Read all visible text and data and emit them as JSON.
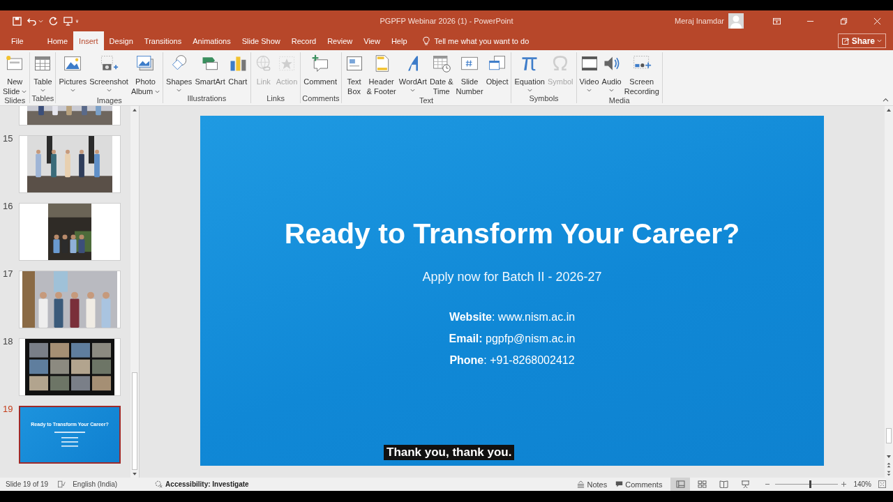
{
  "window": {
    "title": "PGPFP Webinar 2026 (1)  -  PowerPoint",
    "user": "Meraj Inamdar"
  },
  "tabs": [
    {
      "label": "File",
      "selected": false
    },
    {
      "label": "Home",
      "selected": false
    },
    {
      "label": "Insert",
      "selected": true
    },
    {
      "label": "Design",
      "selected": false
    },
    {
      "label": "Transitions",
      "selected": false
    },
    {
      "label": "Animations",
      "selected": false
    },
    {
      "label": "Slide Show",
      "selected": false
    },
    {
      "label": "Record",
      "selected": false
    },
    {
      "label": "Review",
      "selected": false
    },
    {
      "label": "View",
      "selected": false
    },
    {
      "label": "Help",
      "selected": false
    }
  ],
  "tell_me": "Tell me what you want to do",
  "share": "Share",
  "ribbon": [
    {
      "label": "Slides",
      "items": [
        {
          "lines": [
            "New",
            "Slide"
          ],
          "dropdown": true,
          "disabled": false
        }
      ]
    },
    {
      "label": "Tables",
      "items": [
        {
          "lines": [
            "Table"
          ],
          "dropdown": true,
          "disabled": false
        }
      ]
    },
    {
      "label": "Images",
      "items": [
        {
          "lines": [
            "Pictures"
          ],
          "dropdown": true,
          "disabled": false
        },
        {
          "lines": [
            "Screenshot"
          ],
          "dropdown": true,
          "disabled": false
        },
        {
          "lines": [
            "Photo",
            "Album"
          ],
          "dropdown": true,
          "disabled": false
        }
      ]
    },
    {
      "label": "Illustrations",
      "items": [
        {
          "lines": [
            "Shapes"
          ],
          "dropdown": true,
          "disabled": false
        },
        {
          "lines": [
            "SmartArt"
          ],
          "dropdown": false,
          "disabled": false
        },
        {
          "lines": [
            "Chart"
          ],
          "dropdown": false,
          "disabled": false
        }
      ]
    },
    {
      "label": "Links",
      "items": [
        {
          "lines": [
            "Link"
          ],
          "dropdown": false,
          "disabled": true
        },
        {
          "lines": [
            "Action"
          ],
          "dropdown": false,
          "disabled": true
        }
      ]
    },
    {
      "label": "Comments",
      "items": [
        {
          "lines": [
            "Comment"
          ],
          "dropdown": false,
          "disabled": false
        }
      ]
    },
    {
      "label": "Text",
      "items": [
        {
          "lines": [
            "Text",
            "Box"
          ],
          "dropdown": false,
          "disabled": false
        },
        {
          "lines": [
            "Header",
            "& Footer"
          ],
          "dropdown": false,
          "disabled": false
        },
        {
          "lines": [
            "WordArt"
          ],
          "dropdown": true,
          "disabled": false
        },
        {
          "lines": [
            "Date &",
            "Time"
          ],
          "dropdown": false,
          "disabled": false
        },
        {
          "lines": [
            "Slide",
            "Number"
          ],
          "dropdown": false,
          "disabled": false
        },
        {
          "lines": [
            "Object"
          ],
          "dropdown": false,
          "disabled": false
        }
      ]
    },
    {
      "label": "Symbols",
      "items": [
        {
          "lines": [
            "Equation"
          ],
          "dropdown": true,
          "disabled": false
        },
        {
          "lines": [
            "Symbol"
          ],
          "dropdown": false,
          "disabled": true
        }
      ]
    },
    {
      "label": "Media",
      "items": [
        {
          "lines": [
            "Video"
          ],
          "dropdown": true,
          "disabled": false
        },
        {
          "lines": [
            "Audio"
          ],
          "dropdown": true,
          "disabled": false
        },
        {
          "lines": [
            "Screen",
            "Recording"
          ],
          "dropdown": false,
          "disabled": false
        }
      ]
    }
  ],
  "thumbnails": [
    {
      "kind": "picture",
      "selected": false
    },
    {
      "number": "15",
      "kind": "picture",
      "selected": false
    },
    {
      "number": "16",
      "kind": "picture",
      "selected": false
    },
    {
      "number": "17",
      "kind": "picture",
      "selected": false
    },
    {
      "number": "18",
      "kind": "picture",
      "selected": false
    },
    {
      "number": "19",
      "kind": "slide",
      "title": "Ready to Transform Your Career?",
      "selected": true
    }
  ],
  "slide": {
    "title": "Ready to Transform Your Career?",
    "subtitle": "Apply now for Batch II - 2026-27",
    "contacts": [
      "**Website**: www.nism.ac.in",
      "**Email:** pgpfp@nism.ac.in",
      "**Phone**: +91-8268002412"
    ]
  },
  "caption": "Thank you, thank you.",
  "status_bar": {
    "slide_info": "Slide 19 of 19",
    "language": "English (India)",
    "accessibility": "Accessibility: Investigate",
    "notes": "Notes",
    "comments": "Comments",
    "views": [
      {
        "selected": true
      },
      {
        "selected": false
      },
      {
        "selected": false
      },
      {
        "selected": false
      }
    ],
    "zoom": {
      "level": 0.55
    },
    "zoom_percent": "140%"
  }
}
